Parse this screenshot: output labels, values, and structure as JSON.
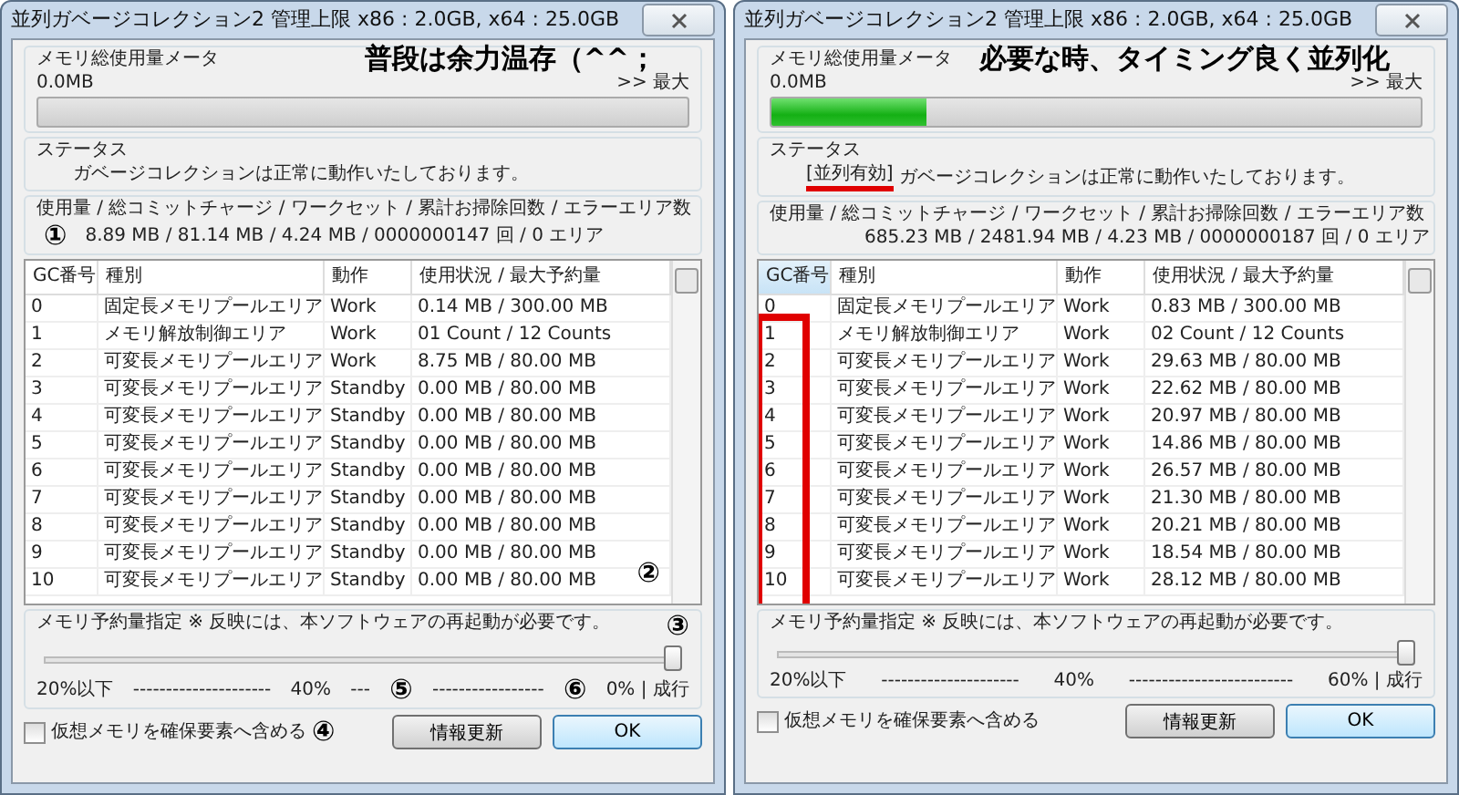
{
  "windows": [
    {
      "title": "並列ガベージコレクション2 管理上限 x86 : 2.0GB, x64 : 25.0GB",
      "caption": "普段は余力温存（^^；",
      "meter": {
        "label": "メモリ総使用量メータ",
        "value": "0.0MB",
        "max_label": ">> 最大",
        "level": 0
      },
      "status": {
        "label": "ステータス",
        "message": "ガベージコレクションは正常に動作いたしております。"
      },
      "stats": {
        "label": "使用量 / 総コミットチャージ / ワークセット / 累計お掃除回数 / エラーエリア数",
        "marker": "①",
        "value": "8.89 MB / 81.14 MB / 4.24 MB / 0000000147 回 / 0 エリア"
      },
      "table": {
        "marker": "②",
        "highlight_box": false,
        "columns": [
          {
            "label": "GC番号",
            "sorted": false
          },
          {
            "label": "種別",
            "sorted": false
          },
          {
            "label": "動作",
            "sorted": false
          },
          {
            "label": "使用状況 / 最大予約量",
            "sorted": false
          }
        ],
        "rows": [
          [
            "0",
            "固定長メモリプールエリア",
            "Work",
            "0.14 MB / 300.00 MB"
          ],
          [
            "1",
            "メモリ解放制御エリア",
            "Work",
            "01 Count / 12 Counts"
          ],
          [
            "2",
            "可変長メモリプールエリア",
            "Work",
            "8.75 MB / 80.00 MB"
          ],
          [
            "3",
            "可変長メモリプールエリア",
            "Standby",
            "0.00 MB / 80.00 MB"
          ],
          [
            "4",
            "可変長メモリプールエリア",
            "Standby",
            "0.00 MB / 80.00 MB"
          ],
          [
            "5",
            "可変長メモリプールエリア",
            "Standby",
            "0.00 MB / 80.00 MB"
          ],
          [
            "6",
            "可変長メモリプールエリア",
            "Standby",
            "0.00 MB / 80.00 MB"
          ],
          [
            "7",
            "可変長メモリプールエリア",
            "Standby",
            "0.00 MB / 80.00 MB"
          ],
          [
            "8",
            "可変長メモリプールエリア",
            "Standby",
            "0.00 MB / 80.00 MB"
          ],
          [
            "9",
            "可変長メモリプールエリア",
            "Standby",
            "0.00 MB / 80.00 MB"
          ],
          [
            "10",
            "可変長メモリプールエリア",
            "Standby",
            "0.00 MB / 80.00 MB"
          ]
        ]
      },
      "reserve": {
        "label": "メモリ予約量指定 ※ 反映には、本ソフトウェアの再起動が必要です。",
        "marker": "③",
        "level": 1,
        "scale": [
          {
            "kind": "label",
            "text": "20%以下"
          },
          {
            "kind": "dashes",
            "text": "---------------------"
          },
          {
            "kind": "label",
            "text": "40%"
          },
          {
            "kind": "dashes",
            "text": "---"
          },
          {
            "kind": "marker",
            "text": "⑤"
          },
          {
            "kind": "dashes",
            "text": "-----------------"
          },
          {
            "kind": "marker",
            "text": "⑥"
          },
          {
            "kind": "label",
            "text": "0% | 成行"
          }
        ]
      },
      "virtual_memory": {
        "label": "仮想メモリを確保要素へ含める",
        "checked": false,
        "marker": "④"
      },
      "buttons": [
        {
          "label": "情報更新",
          "default": false
        },
        {
          "label": "OK",
          "default": true
        }
      ]
    },
    {
      "title": "並列ガベージコレクション2 管理上限 x86 : 2.0GB, x64 : 25.0GB",
      "caption": "必要な時、タイミング良く並列化",
      "meter": {
        "label": "メモリ総使用量メータ",
        "value": "0.0MB",
        "max_label": ">> 最大",
        "level": 0.24
      },
      "status": {
        "label": "ステータス",
        "tag": "[並列有効]",
        "message": "ガベージコレクションは正常に動作いたしております。"
      },
      "stats": {
        "label": "使用量 / 総コミットチャージ / ワークセット / 累計お掃除回数 / エラーエリア数",
        "value": "685.23 MB / 2481.94 MB / 4.23 MB / 0000000187 回 / 0 エリア"
      },
      "table": {
        "highlight_box": true,
        "columns": [
          {
            "label": "GC番号",
            "sorted": true
          },
          {
            "label": "種別",
            "sorted": false
          },
          {
            "label": "動作",
            "sorted": false
          },
          {
            "label": "使用状況 / 最大予約量",
            "sorted": false
          }
        ],
        "rows": [
          [
            "0",
            "固定長メモリプールエリア",
            "Work",
            "0.83 MB / 300.00 MB"
          ],
          [
            "1",
            "メモリ解放制御エリア",
            "Work",
            "02 Count / 12 Counts"
          ],
          [
            "2",
            "可変長メモリプールエリア",
            "Work",
            "29.63 MB / 80.00 MB"
          ],
          [
            "3",
            "可変長メモリプールエリア",
            "Work",
            "22.62 MB / 80.00 MB"
          ],
          [
            "4",
            "可変長メモリプールエリア",
            "Work",
            "20.97 MB / 80.00 MB"
          ],
          [
            "5",
            "可変長メモリプールエリア",
            "Work",
            "14.86 MB / 80.00 MB"
          ],
          [
            "6",
            "可変長メモリプールエリア",
            "Work",
            "26.57 MB / 80.00 MB"
          ],
          [
            "7",
            "可変長メモリプールエリア",
            "Work",
            "21.30 MB / 80.00 MB"
          ],
          [
            "8",
            "可変長メモリプールエリア",
            "Work",
            "20.21 MB / 80.00 MB"
          ],
          [
            "9",
            "可変長メモリプールエリア",
            "Work",
            "18.54 MB / 80.00 MB"
          ],
          [
            "10",
            "可変長メモリプールエリア",
            "Work",
            "28.12 MB / 80.00 MB"
          ]
        ]
      },
      "reserve": {
        "label": "メモリ予約量指定 ※ 反映には、本ソフトウェアの再起動が必要です。",
        "level": 1,
        "scale": [
          {
            "kind": "label",
            "text": "20%以下"
          },
          {
            "kind": "dashes",
            "text": "---------------------"
          },
          {
            "kind": "label",
            "text": "40%"
          },
          {
            "kind": "dashes",
            "text": "-------------------------"
          },
          {
            "kind": "label",
            "text": "60% | 成行"
          }
        ]
      },
      "virtual_memory": {
        "label": "仮想メモリを確保要素へ含める",
        "checked": false
      },
      "buttons": [
        {
          "label": "情報更新",
          "default": false
        },
        {
          "label": "OK",
          "default": true
        }
      ]
    }
  ]
}
